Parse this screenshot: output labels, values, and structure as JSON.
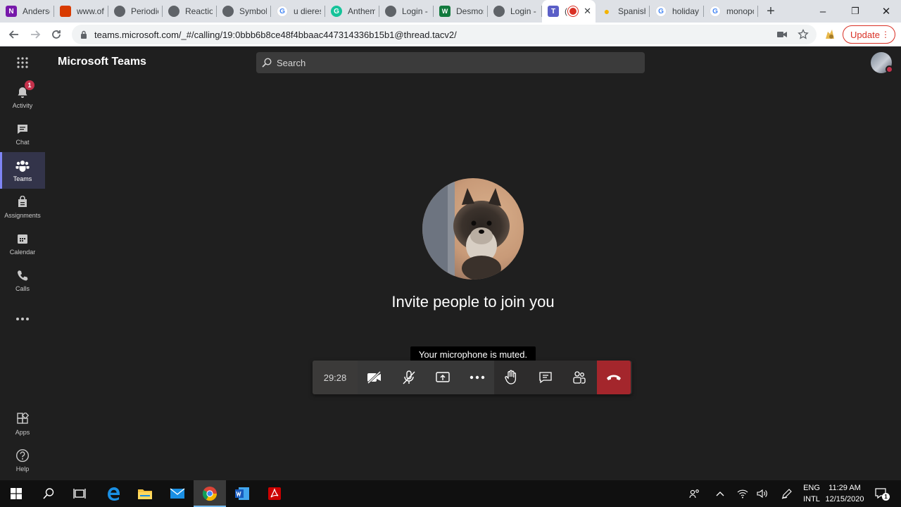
{
  "browser": {
    "tabs": [
      {
        "label": "Anderson",
        "favicon": "onenote-icon",
        "color": "#7719aa"
      },
      {
        "label": "www.office",
        "favicon": "office-icon",
        "color": "#d83b01"
      },
      {
        "label": "Periodic",
        "favicon": "globe-icon",
        "color": "#5f6368"
      },
      {
        "label": "Reaction",
        "favicon": "globe-icon",
        "color": "#5f6368"
      },
      {
        "label": "Symbol",
        "favicon": "globe-icon",
        "color": "#5f6368"
      },
      {
        "label": "u dieresis",
        "favicon": "google-icon",
        "color": "#4285f4"
      },
      {
        "label": "Anthem",
        "favicon": "grammarly-icon",
        "color": "#15c39a"
      },
      {
        "label": "Login -",
        "favicon": "globe-icon",
        "color": "#5f6368"
      },
      {
        "label": "Desmos",
        "favicon": "desmos-icon",
        "color": "#127a3e"
      },
      {
        "label": "Login -",
        "favicon": "globe-icon",
        "color": "#5f6368"
      },
      {
        "label": "(",
        "favicon": "teams-icon",
        "color": "#5b5fc7",
        "active": true
      },
      {
        "label": "Spanish",
        "favicon": "bulb-icon",
        "color": "#f4b400"
      },
      {
        "label": "holiday",
        "favicon": "google-icon",
        "color": "#4285f4"
      },
      {
        "label": "monopoly",
        "favicon": "google-icon",
        "color": "#4285f4"
      }
    ],
    "new_tab_symbol": "+",
    "window_controls": {
      "minimize": "–",
      "restore": "❐",
      "close": "✕"
    },
    "url": "teams.microsoft.com/_#/calling/19:0bbb6b8ce48f4bbaac447314336b15b1@thread.tacv2/",
    "update_label": "Update"
  },
  "teams": {
    "title": "Microsoft Teams",
    "search_placeholder": "Search",
    "rail": [
      {
        "label": "Activity",
        "icon": "bell-icon",
        "badge": "1"
      },
      {
        "label": "Chat",
        "icon": "chat-icon"
      },
      {
        "label": "Teams",
        "icon": "teams-icon",
        "active": true
      },
      {
        "label": "Assignments",
        "icon": "assignments-icon"
      },
      {
        "label": "Calendar",
        "icon": "calendar-icon"
      },
      {
        "label": "Calls",
        "icon": "phone-icon"
      },
      {
        "label": "...",
        "icon": "more-icon"
      }
    ],
    "rail_bottom": [
      {
        "label": "Apps",
        "icon": "apps-icon"
      },
      {
        "label": "Help",
        "icon": "help-icon"
      }
    ]
  },
  "call": {
    "invite_text": "Invite people to join you",
    "mic_tooltip": "Your microphone is muted.",
    "timer": "29:28",
    "controls": [
      "camera-off",
      "mic-off",
      "share-screen",
      "more-actions",
      "raise-hand",
      "chat",
      "participants",
      "hang-up"
    ]
  },
  "taskbar": {
    "language_line1": "ENG",
    "language_line2": "INTL",
    "time": "11:29 AM",
    "date": "12/15/2020",
    "notification_count": "1"
  }
}
